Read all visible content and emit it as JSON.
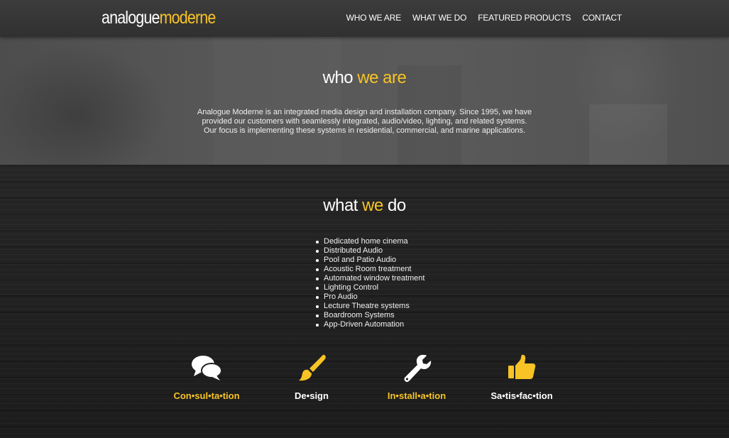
{
  "header": {
    "logo_part1": "analogue",
    "logo_part2": "moderne",
    "nav": [
      "WHO WE ARE",
      "WHAT WE DO",
      "FEATURED PRODUCTS",
      "CONTACT"
    ]
  },
  "who": {
    "title_part1": "who",
    "title_part2": "we are",
    "text": "Analogue Moderne is an integrated media design and installation company.  Since 1995, we have provided our customers with seamlessly integrated, audio/video, lighting, and related systems.  Our focus is implementing these systems in residential, commercial, and marine applications."
  },
  "what": {
    "title_part1": "what",
    "title_part2": "we",
    "title_part3": "do",
    "services": [
      "Dedicated home cinema",
      "Distributed Audio",
      "Pool and Patio Audio",
      "Acoustic Room treatment",
      "Automated window treatment",
      "Lighting Control",
      "Pro Audio",
      "Lecture Theatre systems",
      "Boardroom Systems",
      "App-Driven Automation"
    ],
    "features": [
      {
        "label": "Con•sul•ta•tion",
        "icon": "chat-bubbles-icon",
        "color": "#f7c325"
      },
      {
        "label": "De•sign",
        "icon": "paintbrush-icon",
        "color": "#ffffff"
      },
      {
        "label": "In•stall•a•tion",
        "icon": "wrench-icon",
        "color": "#f7c325"
      },
      {
        "label": "Sa•tis•fac•tion",
        "icon": "thumbs-up-icon",
        "color": "#ffffff"
      }
    ]
  },
  "colors": {
    "accent": "#f7c325",
    "header_bg": "#363636",
    "who_bg": "#555555",
    "what_bg": "#222222"
  }
}
